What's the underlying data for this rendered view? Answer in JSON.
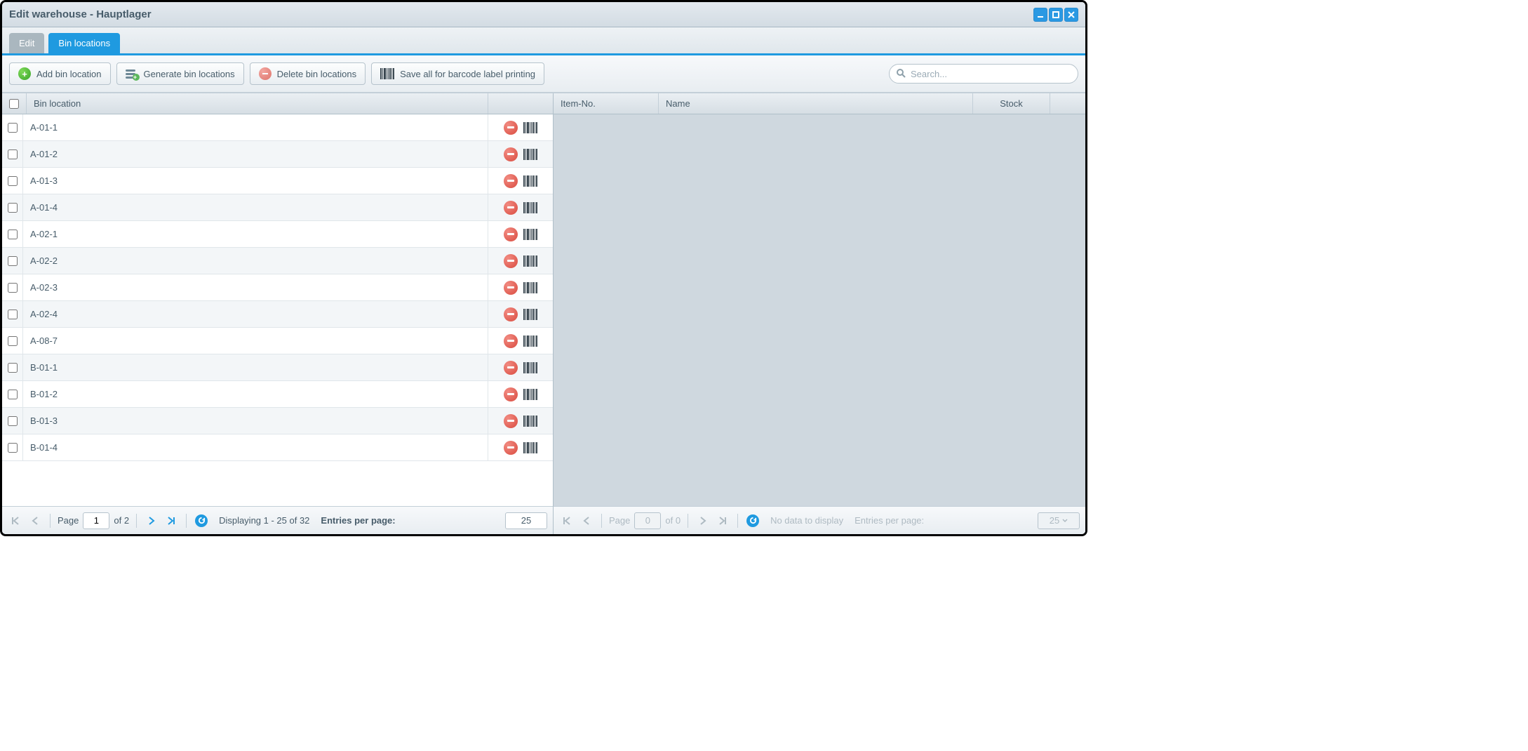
{
  "window": {
    "title": "Edit warehouse - Hauptlager"
  },
  "tabs": [
    {
      "label": "Edit",
      "active": false
    },
    {
      "label": "Bin locations",
      "active": true
    }
  ],
  "toolbar": {
    "add": "Add bin location",
    "generate": "Generate bin locations",
    "delete": "Delete bin locations",
    "save_barcode": "Save all for barcode label printing",
    "search_placeholder": "Search..."
  },
  "left_grid": {
    "header_bin": "Bin location",
    "rows": [
      {
        "name": "A-01-1"
      },
      {
        "name": "A-01-2"
      },
      {
        "name": "A-01-3"
      },
      {
        "name": "A-01-4"
      },
      {
        "name": "A-02-1"
      },
      {
        "name": "A-02-2"
      },
      {
        "name": "A-02-3"
      },
      {
        "name": "A-02-4"
      },
      {
        "name": "A-08-7"
      },
      {
        "name": "B-01-1"
      },
      {
        "name": "B-01-2"
      },
      {
        "name": "B-01-3"
      },
      {
        "name": "B-01-4"
      }
    ],
    "paging": {
      "page_label": "Page",
      "page": "1",
      "of": "of 2",
      "display": "Displaying 1 - 25 of 32",
      "entries_label": "Entries per page:",
      "per_page": "25"
    }
  },
  "right_grid": {
    "headers": {
      "item": "Item-No.",
      "name": "Name",
      "stock": "Stock"
    },
    "paging": {
      "page_label": "Page",
      "page": "0",
      "of": "of 0",
      "display": "No data to display",
      "entries_label": "Entries per page:",
      "per_page": "25"
    }
  }
}
